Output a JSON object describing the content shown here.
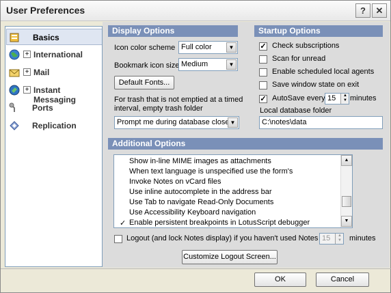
{
  "window": {
    "title": "User Preferences",
    "help_btn": "?",
    "close_btn": "✕"
  },
  "sidebar": {
    "items": [
      {
        "label": "Basics",
        "icon": "basics-icon",
        "selected": true,
        "expandable": false
      },
      {
        "label": "International",
        "icon": "globe-icon",
        "selected": false,
        "expandable": true
      },
      {
        "label": "Mail",
        "icon": "mail-icon",
        "selected": false,
        "expandable": true
      },
      {
        "label": "Instant Messaging",
        "icon": "messaging-icon",
        "selected": false,
        "expandable": true
      },
      {
        "label": "Ports",
        "icon": "ports-icon",
        "selected": false,
        "expandable": false
      },
      {
        "label": "Replication",
        "icon": "replication-icon",
        "selected": false,
        "expandable": false
      }
    ],
    "expand_glyph": "+"
  },
  "display": {
    "header": "Display Options",
    "icon_scheme_label": "Icon color scheme",
    "icon_scheme_value": "Full color",
    "bookmark_size_label": "Bookmark icon size",
    "bookmark_size_value": "Medium",
    "default_fonts_btn": "Default Fonts...",
    "trash_text_line1": "For trash that is not emptied at a timed",
    "trash_text_line2": "interval, empty trash folder",
    "trash_value": "Prompt me during database close"
  },
  "startup": {
    "header": "Startup Options",
    "check_subscriptions": {
      "label": "Check subscriptions",
      "checked": true
    },
    "scan_unread": {
      "label": "Scan for unread",
      "checked": false
    },
    "enable_agents": {
      "label": "Enable scheduled local agents",
      "checked": false
    },
    "save_window_state": {
      "label": "Save window state on exit",
      "checked": false
    },
    "autosave": {
      "label": "AutoSave every",
      "checked": true,
      "minutes": "15",
      "unit": "minutes"
    },
    "local_db_label": "Local database folder",
    "local_db_value": "C:\\notes\\data"
  },
  "additional": {
    "header": "Additional Options",
    "items": [
      {
        "label": "Show in-line MIME images as attachments",
        "checked": false
      },
      {
        "label": "When text language is unspecified use the form's",
        "checked": false
      },
      {
        "label": "Invoke Notes on vCard files",
        "checked": false
      },
      {
        "label": "Use inline autocomplete in the address bar",
        "checked": false
      },
      {
        "label": "Use Tab to navigate Read-Only Documents",
        "checked": false
      },
      {
        "label": "Use Accessibility Keyboard navigation",
        "checked": false
      },
      {
        "label": "Enable persistent breakpoints in LotusScript debugger",
        "checked": true
      }
    ],
    "check_glyph": "✓",
    "logout_label": "Logout (and lock Notes display) if you haven't used Notes for",
    "logout_minutes": "15",
    "logout_unit": "minutes",
    "logout_checked": false,
    "customize_btn": "Customize Logout Screen..."
  },
  "footer": {
    "ok": "OK",
    "cancel": "Cancel"
  },
  "colors": {
    "section_header": "#7a90b8",
    "panel": "#dcdcdc",
    "selected_nav": "#dfe6f2"
  }
}
